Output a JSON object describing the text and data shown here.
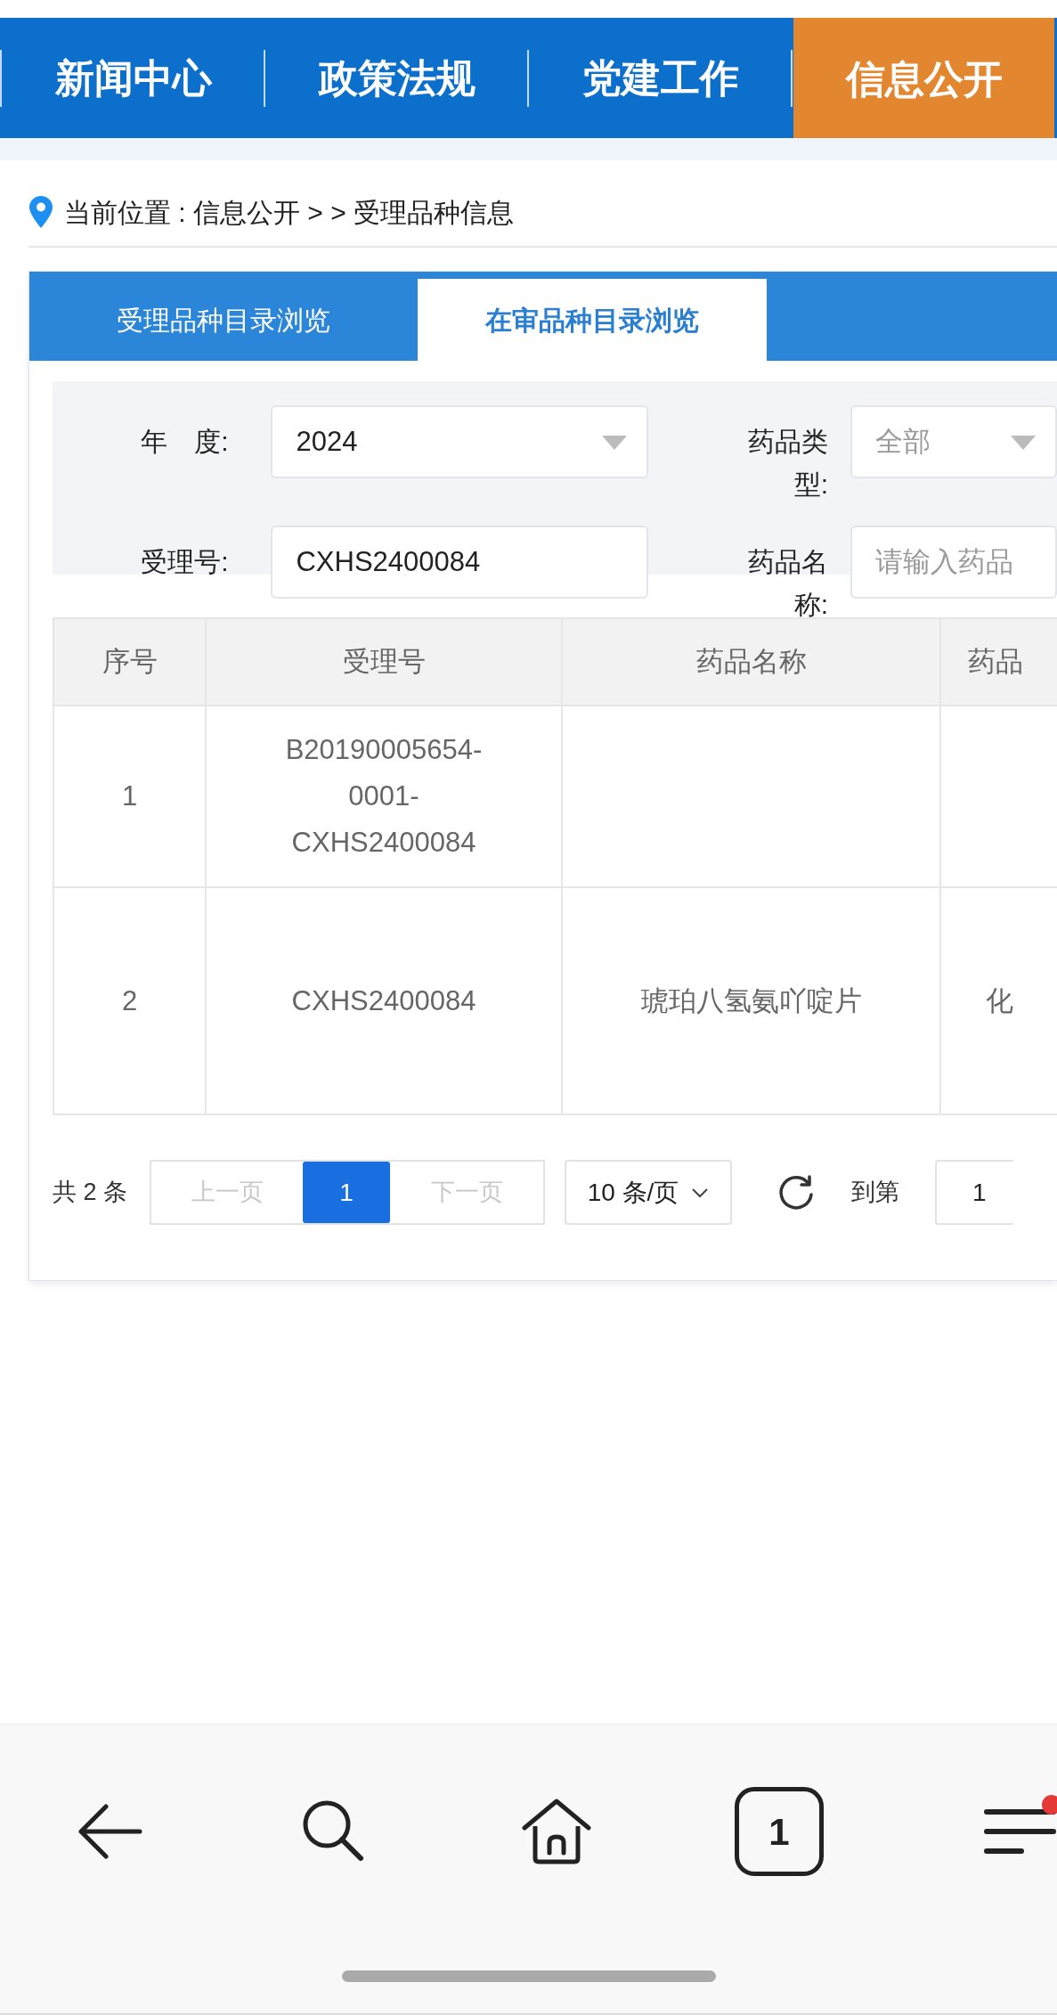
{
  "top_nav": [
    {
      "label": "新闻中心",
      "selected": false
    },
    {
      "label": "政策法规",
      "selected": false
    },
    {
      "label": "党建工作",
      "selected": false
    },
    {
      "label": "信息公开",
      "selected": true
    }
  ],
  "breadcrumb": "当前位置 : 信息公开 > > 受理品种信息",
  "tabs": [
    {
      "label": "受理品种目录浏览",
      "selected": false
    },
    {
      "label": "在审品种目录浏览",
      "selected": true
    }
  ],
  "filters": [
    {
      "label": "年　度:",
      "kind": "select",
      "value": "2024"
    },
    {
      "label": "药品类型:",
      "kind": "select",
      "placeholder": "全部"
    },
    {
      "label": "受理号:",
      "kind": "input",
      "value": "CXHS2400084"
    },
    {
      "label": "药品名称:",
      "kind": "input",
      "placeholder": "请输入药品"
    }
  ],
  "table": {
    "columns": [
      "序号",
      "受理号",
      "药品名称",
      "药品"
    ],
    "rows": [
      {
        "no": "1",
        "acceptance_no": "B20190005654-0001-CXHS2400084"
      },
      {
        "no": "2",
        "acceptance_no": "CXHS2400084",
        "drug_name": "琥珀八氢氨吖啶片",
        "column_4": "化"
      }
    ]
  },
  "pagination": {
    "total": "共 2 条",
    "prev": {
      "label": "上一页",
      "disabled": true
    },
    "pages": [
      {
        "label": "1",
        "selected": true
      }
    ],
    "next": {
      "label": "下一页",
      "disabled": true
    },
    "page_size": "10 条/页",
    "goto_label": "到第",
    "goto_value": "1"
  },
  "browser_bar": {
    "tab_count": "1"
  }
}
